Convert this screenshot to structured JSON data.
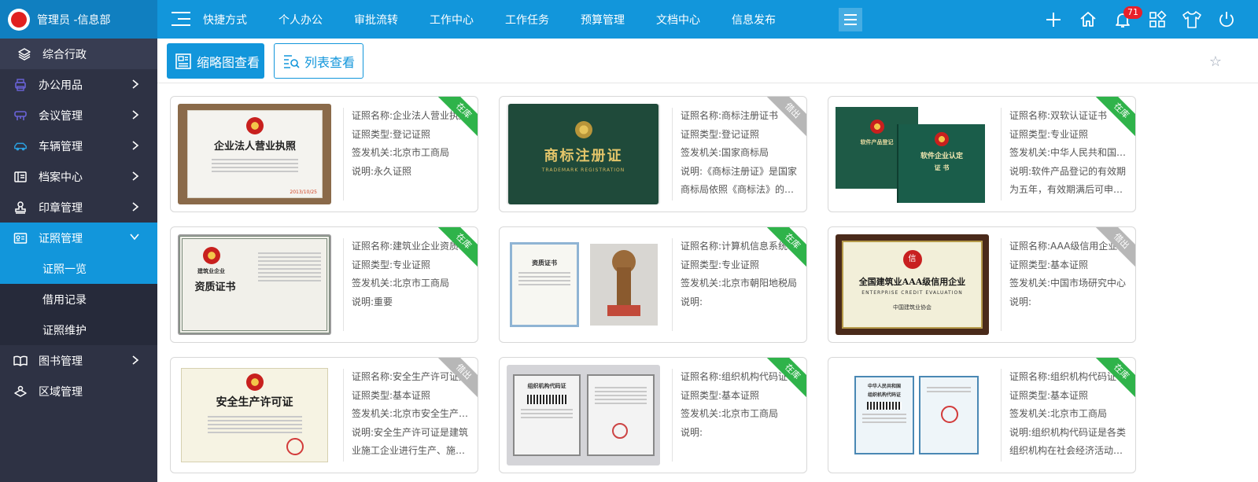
{
  "header": {
    "brand_title": "管理员 -信息部",
    "nav": [
      "快捷方式",
      "个人办公",
      "审批流转",
      "工作中心",
      "工作任务",
      "预算管理",
      "文档中心",
      "信息发布"
    ],
    "notifications": "71",
    "icons": [
      "plus-icon",
      "home-icon",
      "bell-icon",
      "apps-icon",
      "shirt-icon",
      "power-icon"
    ]
  },
  "sidebar": {
    "top": "综合行政",
    "items": [
      {
        "label": "办公用品",
        "icon": "printer-icon"
      },
      {
        "label": "会议管理",
        "icon": "meeting-icon"
      },
      {
        "label": "车辆管理",
        "icon": "car-icon"
      },
      {
        "label": "档案中心",
        "icon": "archive-icon"
      },
      {
        "label": "印章管理",
        "icon": "seal-icon"
      },
      {
        "label": "证照管理",
        "icon": "license-icon"
      },
      {
        "label": "图书管理",
        "icon": "book-icon"
      },
      {
        "label": "区域管理",
        "icon": "region-icon"
      }
    ],
    "sub_items": [
      "证照一览",
      "借用记录",
      "证照维护"
    ]
  },
  "toolbar": {
    "thumb_view": "缩略图查看",
    "list_view": "列表查看"
  },
  "cards": [
    {
      "name": "证照名称:企业法人营业执照",
      "type": "证照类型:登记证照",
      "issuer": "签发机关:北京市工商局",
      "desc": "说明:永久证照",
      "status": "在库",
      "status_color": "#2fb34a",
      "cert": "企业法人营业执照",
      "cert_date": "2013/10/25"
    },
    {
      "name": "证照名称:商标注册证书",
      "type": "证照类型:登记证照",
      "issuer": "签发机关:国家商标局",
      "desc": "说明:《商标注册证》是国家商标局依照《商标法》的规定颁发的",
      "status": "借出",
      "status_color": "#b7b7b7",
      "cert": "商标注册证",
      "cert_sub": "TRADEMARK REGISTRATION"
    },
    {
      "name": "证照名称:双软认证证书",
      "type": "证照类型:专业证照",
      "issuer": "签发机关:中华人民共和国工业和信息化部",
      "desc": "说明:软件产品登记的有效期为五年，有效期满后可申请续延",
      "status": "在库",
      "status_color": "#2fb34a",
      "cert": "软件产品登记",
      "cert_right": "软件企业认定",
      "cert_word": "证 书"
    },
    {
      "name": "证照名称:建筑业企业资质证书",
      "type": "证照类型:专业证照",
      "issuer": "签发机关:北京市工商局",
      "desc": "说明:重要",
      "status": "在库",
      "status_color": "#2fb34a",
      "cert": "资质证书",
      "cert_top": "建筑业企业"
    },
    {
      "name": "证照名称:计算机信息系统集成资质证书",
      "type": "证照类型:专业证照",
      "issuer": "签发机关:北京市朝阳地税局",
      "desc": "说明:",
      "status": "在库",
      "status_color": "#2fb34a",
      "cert": "资质证书"
    },
    {
      "name": "证照名称:AAA级信用企业证书",
      "type": "证照类型:基本证照",
      "issuer": "签发机关:中国市场研究中心",
      "desc": "说明:",
      "status": "借出",
      "status_color": "#b7b7b7",
      "cert": "全国建筑业AAA级信用企业",
      "cert_sub": "ENTERPRISE CREDIT EVALUATION",
      "cert_org": "中国建筑业协会"
    },
    {
      "name": "证照名称:安全生产许可证照",
      "type": "证照类型:基本证照",
      "issuer": "签发机关:北京市安全生产监督管理局",
      "desc": "说明:安全生产许可证是建筑业施工企业进行生产、施工的必备证件",
      "status": "借出",
      "status_color": "#b7b7b7",
      "cert": "安全生产许可证"
    },
    {
      "name": "证照名称:组织机构代码证书",
      "type": "证照类型:基本证照",
      "issuer": "签发机关:北京市工商局",
      "desc": "说明:",
      "status": "在库",
      "status_color": "#2fb34a",
      "cert": "组织机构代码证"
    },
    {
      "name": "证照名称:组织机构代码证书",
      "type": "证照类型:基本证照",
      "issuer": "签发机关:北京市工商局",
      "desc": "说明:组织机构代码证是各类组织机构在社会经济活动中的通行证",
      "status": "在库",
      "status_color": "#2fb34a",
      "cert": "组织机构代码证",
      "cert_top": "中华人民共和国"
    }
  ]
}
